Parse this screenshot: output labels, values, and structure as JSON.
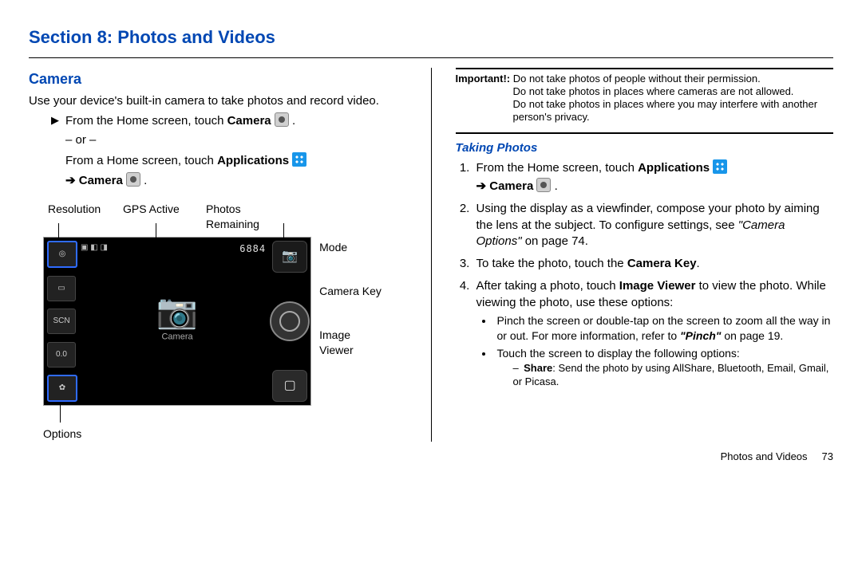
{
  "section_title": "Section 8: Photos and Videos",
  "left": {
    "h2": "Camera",
    "intro": "Use your device's built-in camera to take photos and record video.",
    "step_home": "From the Home screen, touch ",
    "step_home_b": "Camera",
    "or": "– or –",
    "step_alt": "From a Home screen, touch ",
    "step_alt_b": "Applications",
    "step_alt2_b": "Camera",
    "labels": {
      "resolution": "Resolution",
      "gps": "GPS Active",
      "remaining": "Photos Remaining",
      "options": "Options",
      "mode": "Mode",
      "camera_key": "Camera Key",
      "image_viewer": "Image Viewer"
    },
    "cam": {
      "counter": "6884",
      "scn": "SCN",
      "ev": "0.0",
      "center": "Camera"
    }
  },
  "right": {
    "important_lead": "Important!:",
    "important_l1": " Do not take photos of people without their permission.",
    "important_l2": "Do not take photos in places where cameras are not allowed.",
    "important_l3": "Do not take photos in places where you may interfere with another person's privacy.",
    "h3": "Taking Photos",
    "li1a": "From the Home screen, touch ",
    "li1b": "Applications",
    "li1c": "Camera",
    "li2a": "Using the display as a viewfinder, compose your photo by aiming the lens at the subject. To configure settings, see ",
    "li2b": "\"Camera Options\"",
    "li2c": " on page 74.",
    "li3a": "To take the photo, touch the ",
    "li3b": "Camera Key",
    "li4a": "After taking a photo, touch ",
    "li4b": "Image Viewer",
    "li4c": " to view the photo. While viewing the photo, use these options:",
    "b1a": "Pinch the screen or double-tap on the screen to zoom all the way in or out. For more information, refer to ",
    "b1b": "\"Pinch\"",
    "b1c": "  on page 19.",
    "b2": "Touch the screen to display the following options:",
    "s1a": "Share",
    "s1b": ": Send the photo by using AllShare, Bluetooth, Email, Gmail, or Picasa."
  },
  "footer": {
    "sect": "Photos and Videos",
    "page": "73"
  }
}
